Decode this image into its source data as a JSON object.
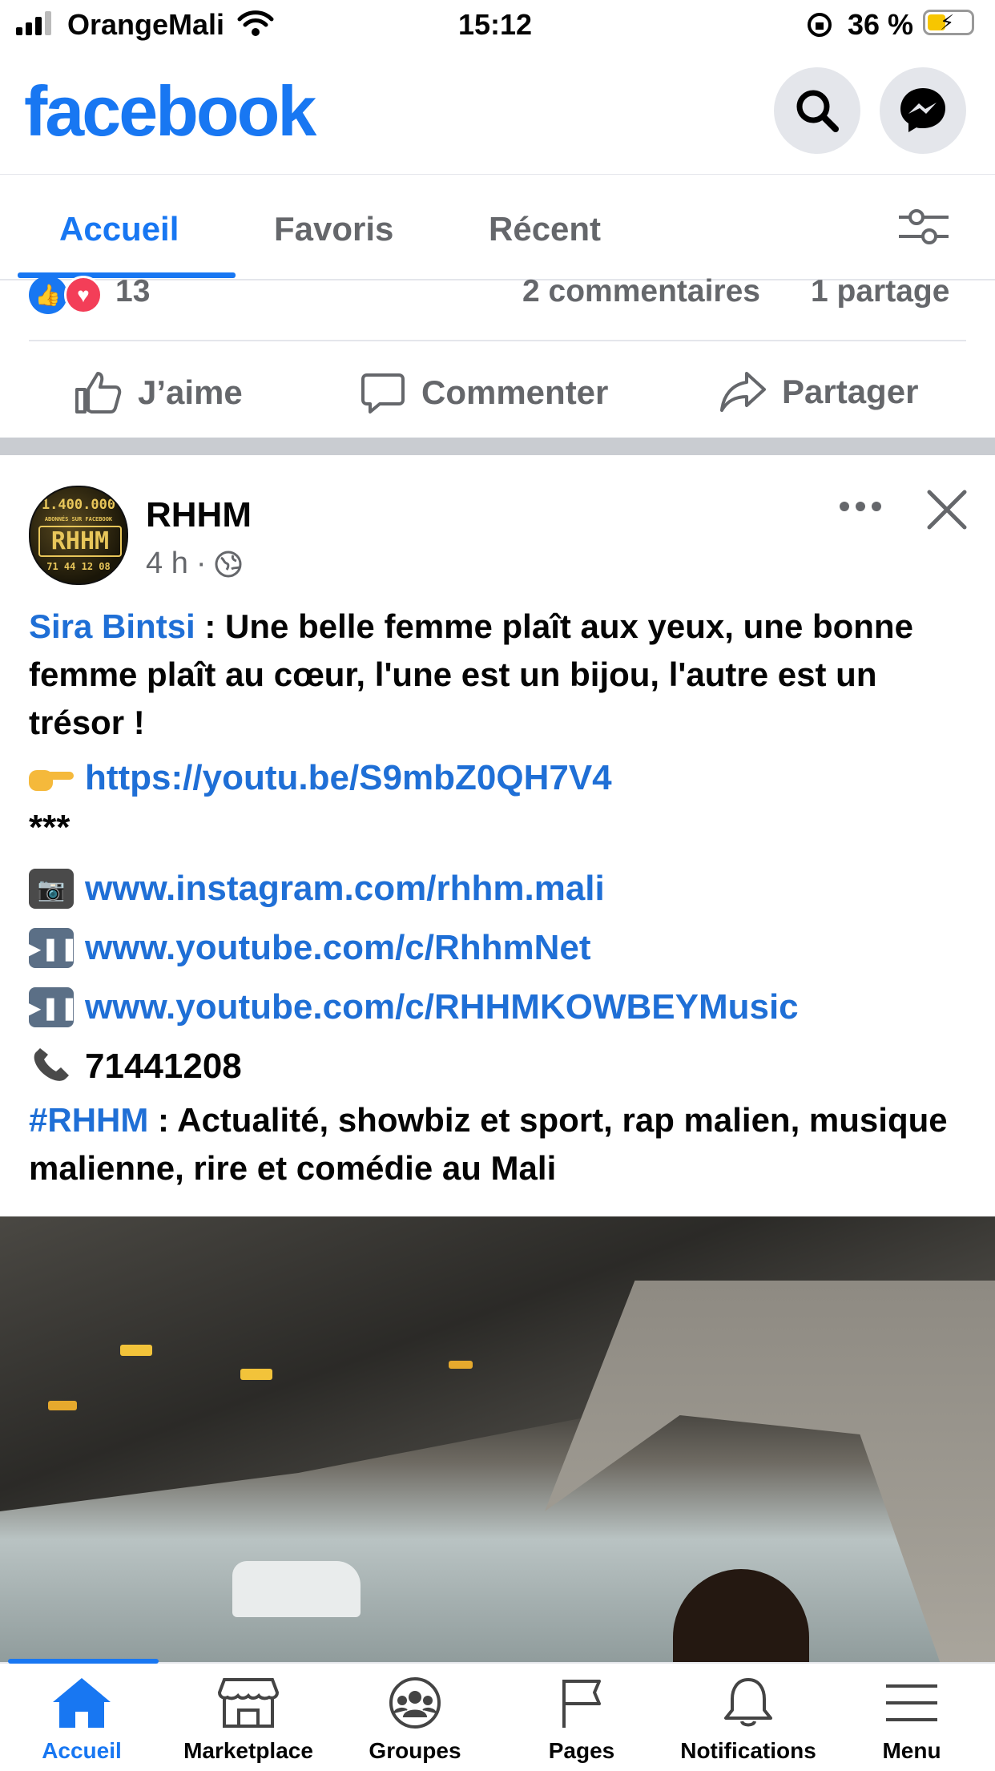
{
  "status_bar": {
    "carrier": "OrangeMali",
    "time": "15:12",
    "battery": "36 %"
  },
  "header": {
    "logo": "facebook"
  },
  "tabs": [
    {
      "label": "Accueil",
      "active": true
    },
    {
      "label": "Favoris",
      "active": false
    },
    {
      "label": "Récent",
      "active": false
    }
  ],
  "reactions": {
    "count": "13",
    "comments": "2 commentaires",
    "shares": "1 partage"
  },
  "actions": {
    "like": "J’aime",
    "comment": "Commenter",
    "share": "Partager"
  },
  "post": {
    "author": "RHHM",
    "time": "4 h",
    "avatar_text": {
      "top": "1.400.000",
      "sub": "ABONNÉS SUR FACEBOOK",
      "name": "RHHM",
      "phone": "71 44 12 08"
    },
    "mention": "Sira Bintsi",
    "text": " : Une belle femme plaît aux yeux, une bonne femme plaît au cœur, l'une est un bijou, l'autre est un trésor !",
    "youtube_link": "https://youtu.be/S9mbZ0QH7V4",
    "stars": "***",
    "instagram": "www.instagram.com/rhhm.mali",
    "youtube1": "www.youtube.com/c/RhhmNet",
    "youtube2": "www.youtube.com/c/RHHMKOWBEYMusic",
    "phone": "71441208",
    "hashtag": "#RHHM",
    "hashtag_text": " : Actualité, showbiz et sport, rap malien, musique malienne, rire et comédie au Mali"
  },
  "bottom_nav": [
    {
      "label": "Accueil",
      "active": true
    },
    {
      "label": "Marketplace",
      "active": false
    },
    {
      "label": "Groupes",
      "active": false
    },
    {
      "label": "Pages",
      "active": false
    },
    {
      "label": "Notifications",
      "active": false
    },
    {
      "label": "Menu",
      "active": false
    }
  ],
  "colors": {
    "brand": "#1877f2",
    "link": "#1f6fd6",
    "muted": "#65676b",
    "love": "#f33e58"
  }
}
